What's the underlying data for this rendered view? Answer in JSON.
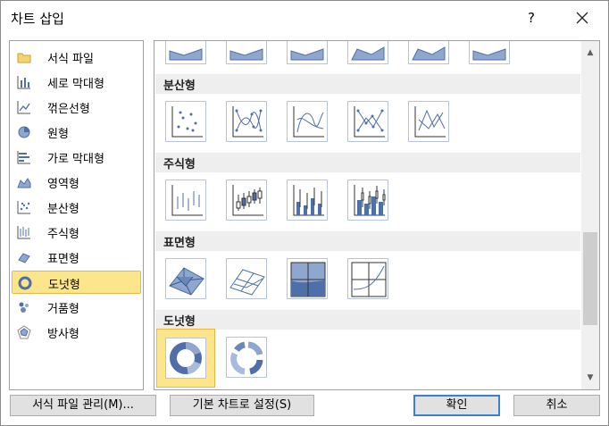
{
  "window": {
    "title": "차트 삽입",
    "help_label": "?"
  },
  "categories": [
    {
      "label": "서식 파일",
      "icon": "folder-icon"
    },
    {
      "label": "세로 막대형",
      "icon": "column-chart-icon"
    },
    {
      "label": "꺾은선형",
      "icon": "line-chart-icon"
    },
    {
      "label": "원형",
      "icon": "pie-chart-icon"
    },
    {
      "label": "가로 막대형",
      "icon": "bar-chart-icon"
    },
    {
      "label": "영역형",
      "icon": "area-chart-icon"
    },
    {
      "label": "분산형",
      "icon": "scatter-chart-icon"
    },
    {
      "label": "주식형",
      "icon": "stock-chart-icon"
    },
    {
      "label": "표면형",
      "icon": "surface-chart-icon"
    },
    {
      "label": "도넛형",
      "icon": "doughnut-chart-icon",
      "selected": true
    },
    {
      "label": "거품형",
      "icon": "bubble-chart-icon"
    },
    {
      "label": "방사형",
      "icon": "radar-chart-icon"
    }
  ],
  "gallery": {
    "sections": [
      {
        "title": "분산형"
      },
      {
        "title": "주식형"
      },
      {
        "title": "표면형"
      },
      {
        "title": "도넛형"
      }
    ]
  },
  "buttons": {
    "manage_templates": "서식 파일 관리(M)...",
    "set_default": "기본 차트로 설정(S)",
    "ok": "확인",
    "cancel": "취소"
  },
  "colors": {
    "selection_fill": "#fde58c",
    "selection_border": "#e8b94a",
    "chart_blue": "#4f6fa8"
  }
}
